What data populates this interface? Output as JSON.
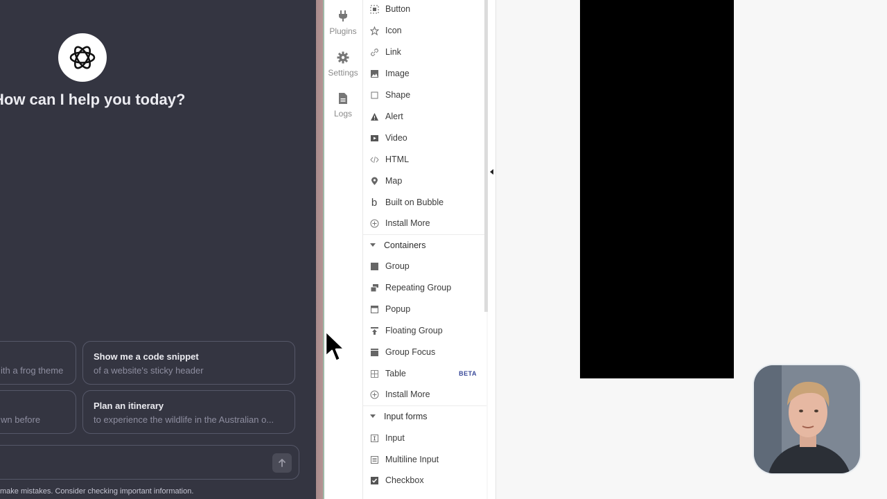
{
  "chat": {
    "heading": "How can I help you today?",
    "suggestions": [
      {
        "title": "",
        "subtitle": "ith a frog theme"
      },
      {
        "title": "Show me a code snippet",
        "subtitle": "of a website's sticky header"
      },
      {
        "title": "",
        "subtitle": "wn before"
      },
      {
        "title": "Plan an itinerary",
        "subtitle": "to experience the wildlife in the Australian o..."
      }
    ],
    "disclaimer": "make mistakes. Consider checking important information."
  },
  "rail": {
    "items": [
      {
        "label": "Plugins",
        "icon": "plug-icon"
      },
      {
        "label": "Settings",
        "icon": "gear-icon"
      },
      {
        "label": "Logs",
        "icon": "document-icon"
      }
    ]
  },
  "panel": {
    "visual_elements": [
      "Button",
      "Icon",
      "Link",
      "Image",
      "Shape",
      "Alert",
      "Video",
      "HTML",
      "Map",
      "Built on Bubble",
      "Install More"
    ],
    "containers_title": "Containers",
    "containers": [
      "Group",
      "Repeating Group",
      "Popup",
      "Floating Group",
      "Group Focus",
      "Table",
      "Install More"
    ],
    "table_badge": "BETA",
    "input_forms_title": "Input forms",
    "input_forms": [
      "Input",
      "Multiline Input",
      "Checkbox"
    ]
  },
  "colors": {
    "chat_bg": "#343541",
    "canvas_bg": "#f7f7f7",
    "accent_badge": "#3a4a9a"
  }
}
